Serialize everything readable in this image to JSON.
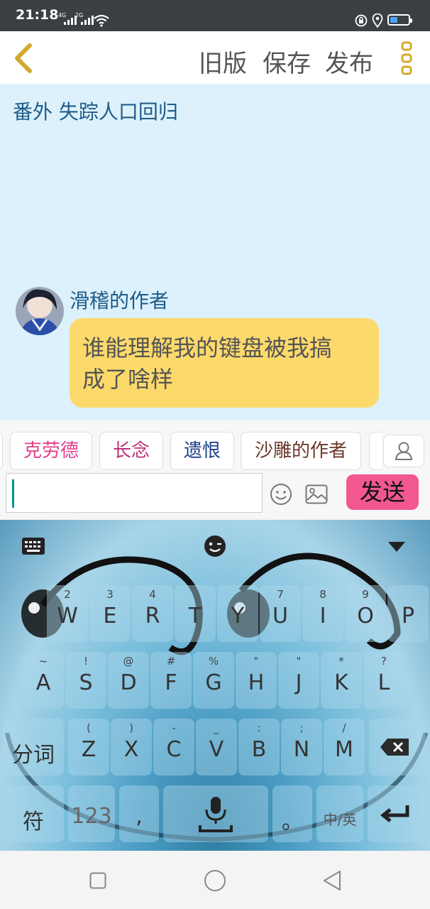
{
  "status_bar": {
    "time": "21:18",
    "net1": "4G",
    "net2": "2G"
  },
  "header": {
    "old_version": "旧版",
    "save": "保存",
    "publish": "发布"
  },
  "story": {
    "title": "番外  失踪人口回归"
  },
  "message": {
    "sender": "滑稽的作者",
    "text_line1": "谁能理解我的键盘被我搞",
    "text_line2": "成了啥样"
  },
  "tags": [
    "克劳德",
    "长念",
    "遗恨",
    "沙雕的作者"
  ],
  "tag_colors": [
    "#e0408a",
    "#c0307a",
    "#1b3e8a",
    "#6a3a2a"
  ],
  "input": {
    "value": "",
    "send_label": "发送"
  },
  "keyboard": {
    "row1": [
      {
        "sub": "2",
        "main": "W"
      },
      {
        "sub": "3",
        "main": "E"
      },
      {
        "sub": "4",
        "main": "R"
      },
      {
        "sub": "",
        "main": "T"
      },
      {
        "sub": "",
        "main": "Y"
      },
      {
        "sub": "7",
        "main": "U"
      },
      {
        "sub": "8",
        "main": "I"
      },
      {
        "sub": "9",
        "main": "O"
      },
      {
        "sub": "",
        "main": "P"
      }
    ],
    "row2": [
      {
        "sub": "~",
        "main": "A"
      },
      {
        "sub": "!",
        "main": "S"
      },
      {
        "sub": "@",
        "main": "D"
      },
      {
        "sub": "#",
        "main": "F"
      },
      {
        "sub": "%",
        "main": "G"
      },
      {
        "sub": "\"",
        "main": "H"
      },
      {
        "sub": "\"",
        "main": "J"
      },
      {
        "sub": "*",
        "main": "K"
      },
      {
        "sub": "?",
        "main": "L"
      }
    ],
    "row3": [
      {
        "sub": "(",
        "main": "Z"
      },
      {
        "sub": ")",
        "main": "X"
      },
      {
        "sub": "-",
        "main": "C"
      },
      {
        "sub": "_",
        "main": "V"
      },
      {
        "sub": ":",
        "main": "B"
      },
      {
        "sub": ";",
        "main": "N"
      },
      {
        "sub": "/",
        "main": "M"
      }
    ],
    "segment_label": "分词",
    "symbols_label": "符",
    "numbers_label": "123",
    "comma": ",",
    "period": "。",
    "lang_label": "中/英"
  },
  "colors": {
    "accent": "#f2578f",
    "header_back": "#d4a82c",
    "content_bg": "#dcf1fb",
    "bubble": "#fcd96b"
  }
}
